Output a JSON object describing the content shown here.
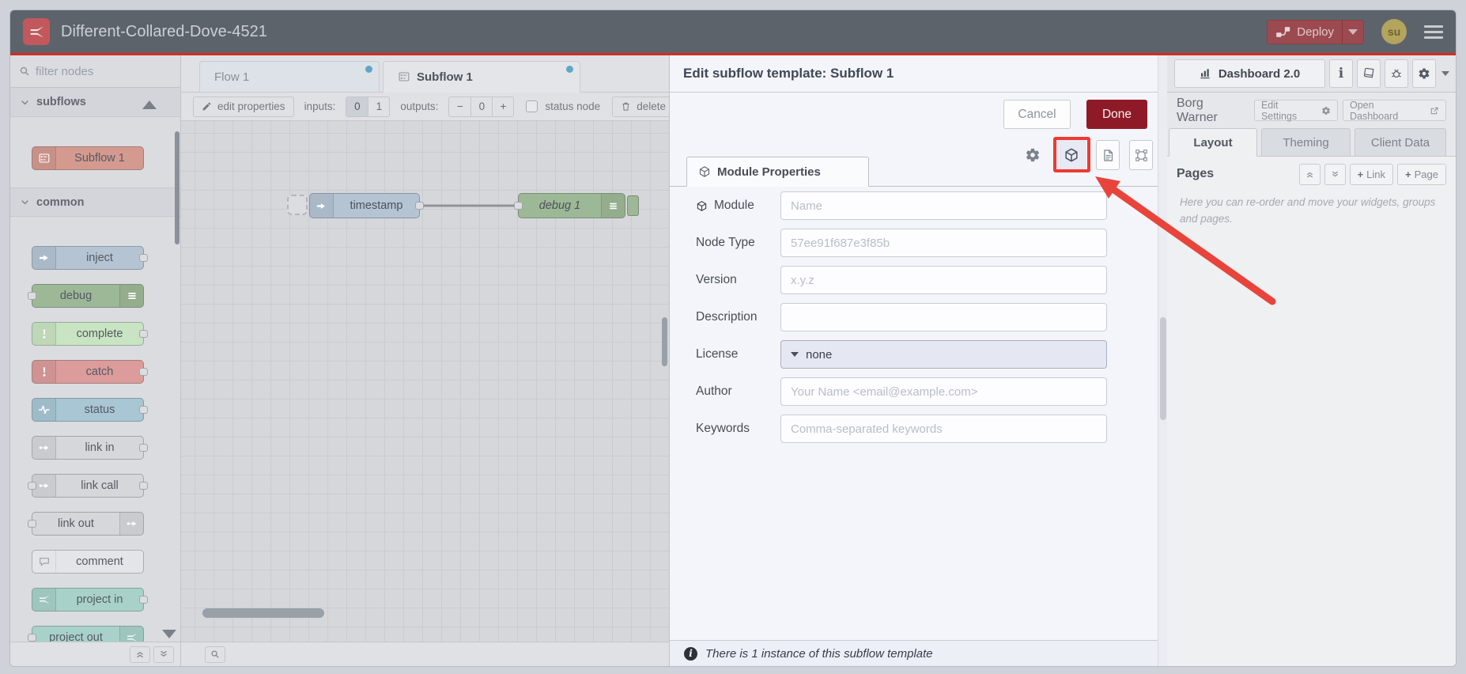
{
  "header": {
    "title": "Different-Collared-Dove-4521",
    "deploy_label": "Deploy",
    "avatar_initials": "su"
  },
  "palette": {
    "search_placeholder": "filter nodes",
    "categories": [
      {
        "label": "subflows",
        "nodes": [
          {
            "label": "Subflow 1",
            "color": "#d49a90",
            "icon": "subflow-icon",
            "icon_side": "left",
            "ports": []
          }
        ]
      },
      {
        "label": "common",
        "nodes": [
          {
            "label": "inject",
            "color": "#b4c4d3",
            "icon": "inject-arrow-icon",
            "icon_side": "left",
            "ports": [
              "right"
            ]
          },
          {
            "label": "debug",
            "color": "#9db896",
            "icon": "debug-lines-icon",
            "icon_side": "right",
            "ports": [
              "left"
            ]
          },
          {
            "label": "complete",
            "color": "#c8e4c2",
            "icon": "exclamation-icon",
            "icon_side": "left",
            "ports": [
              "right"
            ]
          },
          {
            "label": "catch",
            "color": "#dc9c9c",
            "icon": "exclamation-icon",
            "icon_side": "left",
            "ports": [
              "right"
            ]
          },
          {
            "label": "status",
            "color": "#a8c6d4",
            "icon": "waveform-icon",
            "icon_side": "left",
            "ports": [
              "right"
            ]
          },
          {
            "label": "link in",
            "color": "#d6d7da",
            "icon": "link-icon",
            "icon_side": "left",
            "ports": [
              "right"
            ]
          },
          {
            "label": "link call",
            "color": "#d6d7da",
            "icon": "link-icon",
            "icon_side": "left",
            "ports": [
              "left",
              "right"
            ]
          },
          {
            "label": "link out",
            "color": "#d6d7da",
            "icon": "link-icon",
            "icon_side": "right",
            "ports": [
              "left"
            ]
          },
          {
            "label": "comment",
            "color": "#e4e5e9",
            "icon": "comment-icon",
            "icon_side": "left",
            "ports": []
          },
          {
            "label": "project in",
            "color": "#a8d2c9",
            "icon": "node-red-icon",
            "icon_side": "left",
            "ports": [
              "right"
            ]
          },
          {
            "label": "project out",
            "color": "#a8d2c9",
            "icon": "node-red-icon",
            "icon_side": "right",
            "ports": [
              "left"
            ]
          }
        ]
      }
    ]
  },
  "workspace": {
    "tabs": [
      {
        "label": "Flow 1",
        "active": false
      },
      {
        "label": "Subflow 1",
        "active": true
      }
    ],
    "toolbar": {
      "edit_properties_label": "edit properties",
      "inputs_label": "inputs:",
      "input_options": [
        "0",
        "1"
      ],
      "input_selected": "0",
      "outputs_label": "outputs:",
      "outputs_minus": "−",
      "outputs_value": "0",
      "outputs_plus": "+",
      "status_node_label": "status node",
      "delete_subflow_label": "delete subflow"
    },
    "canvas_nodes": [
      {
        "label": "timestamp",
        "type": "inject",
        "color": "#b4c4d3"
      },
      {
        "label": "debug 1",
        "type": "debug",
        "color": "#9db896"
      }
    ]
  },
  "dialog": {
    "title": "Edit subflow template: Subflow 1",
    "cancel_label": "Cancel",
    "done_label": "Done",
    "tab_label": "Module Properties",
    "form": {
      "rows": [
        {
          "label": "Module",
          "type": "text",
          "placeholder": "Name",
          "icon": "cube-icon"
        },
        {
          "label": "Node Type",
          "type": "text",
          "placeholder": "57ee91f687e3f85b"
        },
        {
          "label": "Version",
          "type": "text",
          "placeholder": "x.y.z"
        },
        {
          "label": "Description",
          "type": "text",
          "placeholder": ""
        },
        {
          "label": "License",
          "type": "select",
          "value": "none"
        },
        {
          "label": "Author",
          "type": "text",
          "placeholder": "Your Name <email@example.com>"
        },
        {
          "label": "Keywords",
          "type": "text",
          "placeholder": "Comma-separated keywords"
        }
      ]
    },
    "footer_note": "There is 1 instance of this subflow template"
  },
  "sidebar": {
    "dashboard_tab_label": "Dashboard 2.0",
    "project_label": "Borg Warner",
    "edit_settings_label": "Edit Settings",
    "open_dashboard_label": "Open Dashboard",
    "tabs": [
      {
        "label": "Layout",
        "active": true
      },
      {
        "label": "Theming",
        "active": false
      },
      {
        "label": "Client Data",
        "active": false
      }
    ],
    "pages_title": "Pages",
    "add_link_label": "Link",
    "add_page_label": "Page",
    "help_text": "Here you can re-order and move your widgets, groups and pages."
  },
  "colors": {
    "header_accent_line": "#d62b25",
    "annotation_red": "#e8443b",
    "done_button": "#8e1a28",
    "deploy_button": "#9b4a50",
    "modified_dot": "#5fa7c8"
  }
}
